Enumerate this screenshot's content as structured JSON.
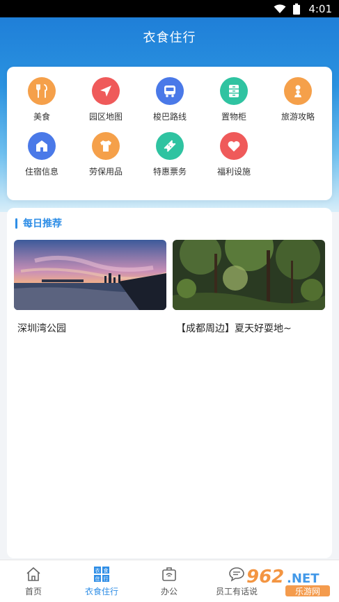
{
  "status": {
    "time": "4:01"
  },
  "header": {
    "title": "衣食住行"
  },
  "grid": {
    "items": [
      {
        "label": "美食",
        "icon": "food-icon",
        "color": "#f5a04a"
      },
      {
        "label": "园区地图",
        "icon": "map-pointer-icon",
        "color": "#ef5a5a"
      },
      {
        "label": "梭巴路线",
        "icon": "bus-icon",
        "color": "#4a79e8"
      },
      {
        "label": "置物柜",
        "icon": "locker-icon",
        "color": "#2fc3a1"
      },
      {
        "label": "旅游攻略",
        "icon": "travel-icon",
        "color": "#f5a04a"
      },
      {
        "label": "住宿信息",
        "icon": "home-icon",
        "color": "#4a79e8"
      },
      {
        "label": "劳保用品",
        "icon": "shirt-icon",
        "color": "#f5a04a"
      },
      {
        "label": "特惠票务",
        "icon": "ticket-icon",
        "color": "#2fc3a1"
      },
      {
        "label": "福利设施",
        "icon": "heart-icon",
        "color": "#ef5a5a"
      }
    ]
  },
  "recommend": {
    "title": "每日推荐",
    "items": [
      {
        "caption": "深圳湾公园"
      },
      {
        "caption": "【成都周边】夏天好耍地~"
      }
    ]
  },
  "tabs": [
    {
      "label": "首页",
      "icon": "home-outline-icon",
      "active": false
    },
    {
      "label": "衣食住行",
      "icon": "clothing-food-icon",
      "active": true
    },
    {
      "label": "办公",
      "icon": "office-icon",
      "active": false
    },
    {
      "label": "员工有话说",
      "icon": "chat-icon",
      "active": false
    }
  ],
  "watermark": {
    "brand": "962.NET",
    "sub": "乐游网"
  },
  "colors": {
    "primary": "#2f8ee6",
    "hero_top": "#1f7fd8"
  }
}
